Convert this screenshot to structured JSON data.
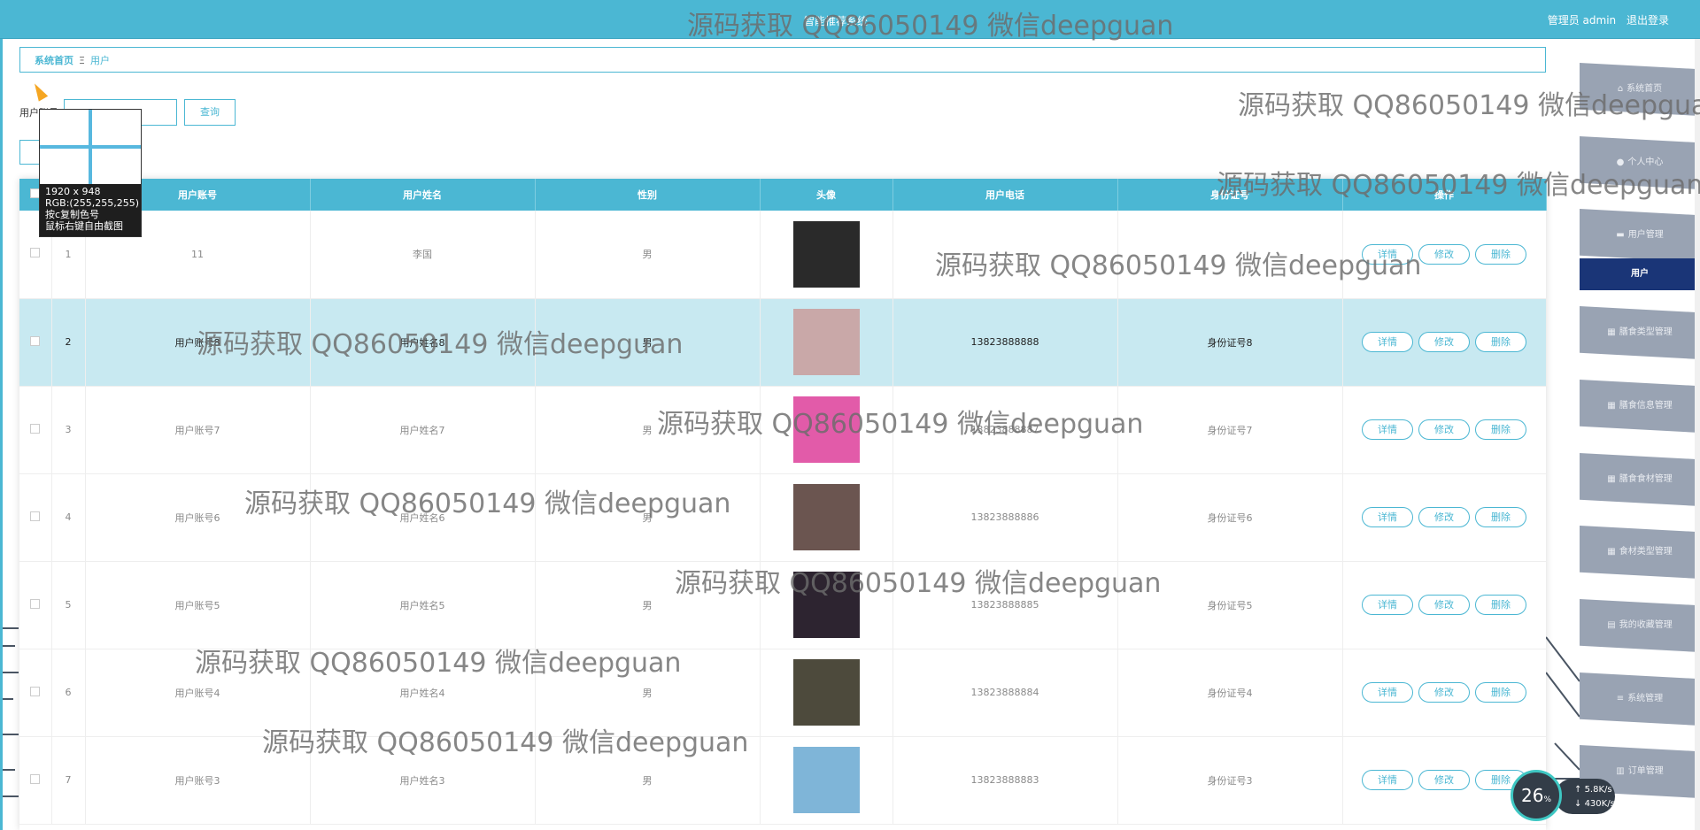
{
  "header": {
    "system_title": "智能推荐系统",
    "user_label": "管理员 admin",
    "logout_label": "退出登录"
  },
  "watermark_text": "源码获取 QQ86050149 微信deepguan",
  "breadcrumb": {
    "home": "系统首页",
    "separator": "Ξ",
    "current": "用户"
  },
  "search": {
    "label": "用户账号",
    "value": "",
    "button": "查询"
  },
  "screen_tool": {
    "size": "1920 x 948",
    "rgb": "RGB:(255,255,255)",
    "copy_hint": "按c复制色号",
    "screenshot_hint": "鼠标右键自由截图"
  },
  "table": {
    "headers": [
      "",
      "",
      "用户账号",
      "用户姓名",
      "性别",
      "头像",
      "用户电话",
      "身份证号",
      "操作"
    ],
    "rows": [
      {
        "index": "1",
        "account": "11",
        "name": "李国",
        "gender": "男",
        "phone": "",
        "id_card": "",
        "avatar_color": "#2a2a2a"
      },
      {
        "index": "2",
        "account": "用户账号8",
        "name": "用户姓名8",
        "gender": "男",
        "phone": "13823888888",
        "id_card": "身份证号8",
        "avatar_color": "#c9a8a8"
      },
      {
        "index": "3",
        "account": "用户账号7",
        "name": "用户姓名7",
        "gender": "男",
        "phone": "13823888887",
        "id_card": "身份证号7",
        "avatar_color": "#e25ba9"
      },
      {
        "index": "4",
        "account": "用户账号6",
        "name": "用户姓名6",
        "gender": "男",
        "phone": "13823888886",
        "id_card": "身份证号6",
        "avatar_color": "#6b5550"
      },
      {
        "index": "5",
        "account": "用户账号5",
        "name": "用户姓名5",
        "gender": "男",
        "phone": "13823888885",
        "id_card": "身份证号5",
        "avatar_color": "#2d2430"
      },
      {
        "index": "6",
        "account": "用户账号4",
        "name": "用户姓名4",
        "gender": "男",
        "phone": "13823888884",
        "id_card": "身份证号4",
        "avatar_color": "#4d4a3c"
      },
      {
        "index": "7",
        "account": "用户账号3",
        "name": "用户姓名3",
        "gender": "男",
        "phone": "13823888883",
        "id_card": "身份证号3",
        "avatar_color": "#7fb5d8"
      }
    ],
    "actions": {
      "detail": "详情",
      "edit": "修改",
      "delete": "删除"
    }
  },
  "sidebar": {
    "items": [
      {
        "label": "系统首页",
        "icon": "home-icon",
        "glyph": "⌂"
      },
      {
        "label": "个人中心",
        "icon": "user-icon",
        "glyph": "●"
      },
      {
        "label": "用户管理",
        "icon": "folder-icon",
        "glyph": "▬"
      },
      {
        "label": "用户",
        "icon": "",
        "glyph": "",
        "active": true
      },
      {
        "label": "膳食类型管理",
        "icon": "grid-icon",
        "glyph": "▦"
      },
      {
        "label": "膳食信息管理",
        "icon": "grid-icon",
        "glyph": "▦"
      },
      {
        "label": "膳食食材管理",
        "icon": "grid-icon",
        "glyph": "▦"
      },
      {
        "label": "食材类型管理",
        "icon": "grid-icon",
        "glyph": "▦"
      },
      {
        "label": "我的收藏管理",
        "icon": "clipboard-icon",
        "glyph": "▤"
      },
      {
        "label": "系统管理",
        "icon": "menu-icon",
        "glyph": "≡"
      },
      {
        "label": "订单管理",
        "icon": "table-icon",
        "glyph": "▥"
      }
    ]
  },
  "net_widget": {
    "percent": "26",
    "percent_unit": "%",
    "up": "5.8",
    "down": "430",
    "unit": "K/s"
  }
}
